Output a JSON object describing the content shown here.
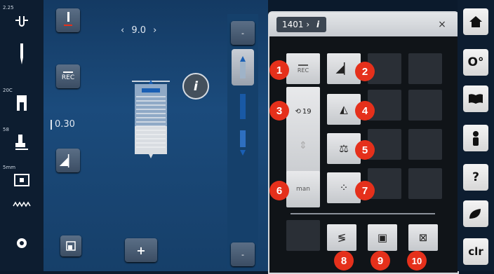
{
  "left_toolbar": {
    "items": [
      {
        "small": "2.25",
        "icon": "needle-thread-icon"
      },
      {
        "small": "",
        "icon": "needle-icon"
      },
      {
        "small": "20C",
        "icon": "presser-foot-icon"
      },
      {
        "small": "58",
        "icon": "foot-pressure-icon"
      },
      {
        "small": "5mm",
        "icon": "stitch-plate-icon"
      },
      {
        "small": "",
        "icon": "feed-dog-icon"
      },
      {
        "small": "",
        "icon": "gear-icon"
      }
    ]
  },
  "main": {
    "stitch_width_value": "9.0",
    "width_prev": "‹",
    "width_next": "›",
    "rec_label": "REC",
    "tension_value": "0.30",
    "info_label": "i",
    "plus_label": "+",
    "minus_top": "-",
    "minus_bottom": "-"
  },
  "dialog": {
    "breadcrumb_number": "1401",
    "breadcrumb_info": "i",
    "close_label": "×",
    "cells": {
      "rec": "REC",
      "pattern_number": "19",
      "man": "man"
    },
    "badges": [
      "1",
      "2",
      "3",
      "4",
      "5",
      "6",
      "7",
      "8",
      "9",
      "10"
    ]
  },
  "right_toolbar": {
    "clr_label": "clr",
    "help_label": "?"
  },
  "colors": {
    "accent_red": "#e5301b",
    "main_blue": "#1b4b7c",
    "dialog_bg": "#101418"
  }
}
